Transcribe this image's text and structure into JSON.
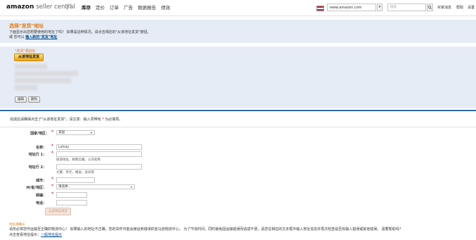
{
  "header": {
    "logo_brand": "amazon",
    "logo_product": "seller central",
    "nav": [
      "库存",
      "定价",
      "订单",
      "广告",
      "数据报告",
      "绩效"
    ],
    "active_nav_index": 0,
    "marketplace": "www.amazon.com",
    "search_placeholder": "搜索",
    "links": [
      "买家消息",
      "帮助",
      "设置"
    ]
  },
  "intro": {
    "title": "选择\"发货\"地址",
    "line1": "下面显示出您想要使用的地址了吗？ 如果是这种情况，请点击相应的\"从该地址发货\"按钮。",
    "line2_prefix": "或 您可以",
    "line2_link": "输入新的\"发货\"地址"
  },
  "saved_address": {
    "title": "\"发货\"源自处",
    "ship_button": "从该地址发货",
    "edit_button": "编辑",
    "delete_button": "删除"
  },
  "instruction": {
    "text": "完成后请确保点击了\"从该地址发货\"。请注意：输入项带有",
    "star": "*",
    "suffix": "为必填项。"
  },
  "form": {
    "country_label": "国家/地区：",
    "country_value": "美国",
    "name_label": "名称：",
    "name_value": "Lafedy",
    "addr1_label": "地址行 1：",
    "addr1_hint": "街道地址，邮政信箱，公司名称",
    "addr2_label": "地址行 2：",
    "addr2_hint": "大厦、单元、楼层、房间等",
    "city_label": "城市：",
    "state_label": "州/省/地区：",
    "state_value": "请选择...",
    "zip_label": "邮编：",
    "phone_label": "电话：",
    "submit_button": "从该地址发货"
  },
  "note": {
    "title": "地址请确认",
    "body": "请务必将您作运输至正确的物流中心！ 如果输入的地址不正确，您的货件可能会被运到错误的亚马逊物流中心。 为了节省时间，同时避免因运输错误而造成不便，请您在相应的文本框中输入地址信息并再次检查是否有输入错误或其他错误。 需要帮助吗？",
    "link_prefix": "点击查看地址提示：",
    "link": "一般地址提示"
  }
}
